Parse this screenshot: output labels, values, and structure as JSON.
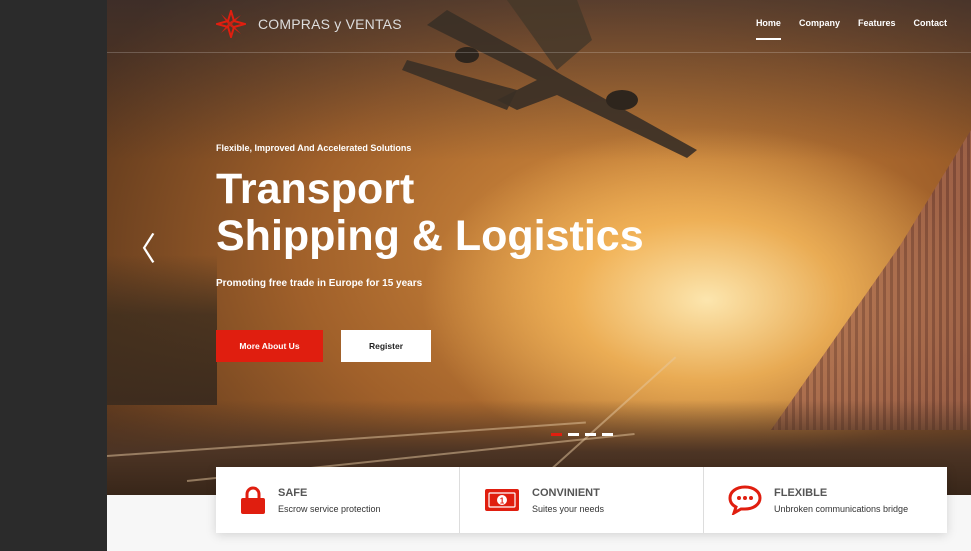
{
  "brand": {
    "name": "COMPRAS y VENTAS",
    "icon": "compass-star-icon",
    "accent": "#e01e0f"
  },
  "nav": {
    "items": [
      {
        "label": "Home",
        "active": true
      },
      {
        "label": "Company",
        "active": false
      },
      {
        "label": "Features",
        "active": false
      },
      {
        "label": "Contact",
        "active": false
      }
    ]
  },
  "hero": {
    "eyebrow": "Flexible, Improved And Accelerated Solutions",
    "headline_line1": "Transport",
    "headline_line2": "Shipping & Logistics",
    "subline": "Promoting free trade in Europe for 15 years",
    "primary_button": "More About Us",
    "secondary_button": "Register",
    "prev_arrow": "〈",
    "slide_count": 4,
    "active_slide": 1
  },
  "features": [
    {
      "title": "SAFE",
      "desc": "Escrow service protection",
      "icon": "padlock-icon"
    },
    {
      "title": "CONVINIENT",
      "desc": "Suites your needs",
      "icon": "banknote-icon"
    },
    {
      "title": "FLEXIBLE",
      "desc": "Unbroken communications bridge",
      "icon": "chat-bubble-icon"
    }
  ]
}
